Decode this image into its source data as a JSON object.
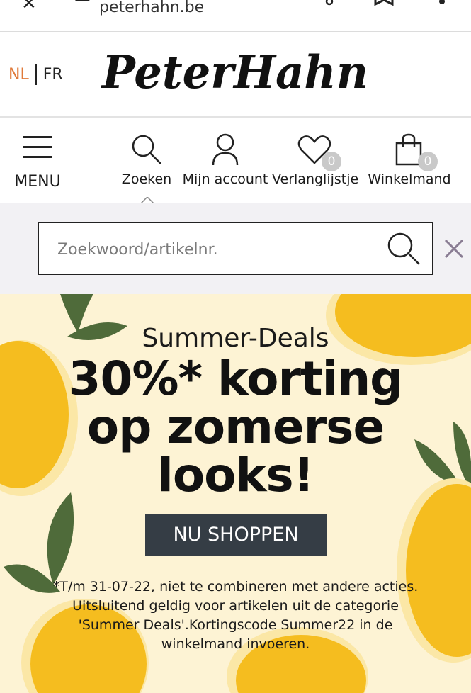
{
  "browser": {
    "url": "peterhahn.be"
  },
  "header": {
    "lang_nl": "NL",
    "lang_fr": "FR",
    "logo_text": "PeterHahn"
  },
  "nav": {
    "menu_label": "MENU",
    "search_label": "Zoeken",
    "account_label": "Mijn account",
    "wishlist_label": "Verlanglijstje",
    "wishlist_count": "0",
    "cart_label": "Winkelmand",
    "cart_count": "0"
  },
  "search": {
    "placeholder": "Zoekwoord/artikelnr.",
    "value": ""
  },
  "promo": {
    "eyebrow": "Summer-Deals",
    "headline_line1": "30%* korting",
    "headline_line2": "op zomerse",
    "headline_line3": "looks!",
    "cta_label": "NU SHOPPEN",
    "terms_line1": "*T/m 31-07-22, niet te combineren met andere acties.",
    "terms_line2": "Uitsluitend geldig voor artikelen uit de categorie",
    "terms_line3": "'Summer Deals'.Kortingscode Summer22 in de",
    "terms_line4": "winkelmand invoeren."
  },
  "colors": {
    "accent_nl": "#e07a3a",
    "promo_bg": "#fdf3d4",
    "lemon": "#f5bd1f",
    "leaf": "#4f6b3a",
    "cta_bg": "#353d45"
  }
}
